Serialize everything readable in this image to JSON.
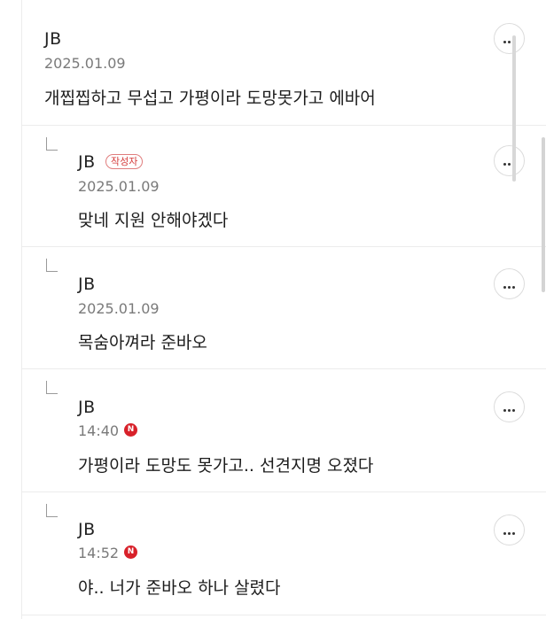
{
  "comments": [
    {
      "author": "JB",
      "date": "2025.01.09",
      "text": "개찝찝하고 무섭고 가평이라 도망못가고 에바어",
      "is_reply": false
    },
    {
      "author": "JB",
      "author_badge": "작성자",
      "date": "2025.01.09",
      "text": "맞네 지원 안해야겠다",
      "is_reply": true
    },
    {
      "author": "JB",
      "date": "2025.01.09",
      "text": "목숨아껴라 준바오",
      "is_reply": true
    },
    {
      "author": "JB",
      "date": "14:40",
      "new_badge": "N",
      "text": "가평이라 도망도 못가고.. 선견지명 오졌다",
      "is_reply": true
    },
    {
      "author": "JB",
      "date": "14:52",
      "new_badge": "N",
      "text": "야.. 너가 준바오 하나 살렸다",
      "is_reply": true
    }
  ],
  "icons": {
    "more": "more-options-icon",
    "reply": "reply-arrow-icon"
  },
  "colors": {
    "author_badge": "#d43b3b",
    "new_badge": "#d8212a",
    "divider": "#ececec",
    "date": "#7a7a7a"
  }
}
